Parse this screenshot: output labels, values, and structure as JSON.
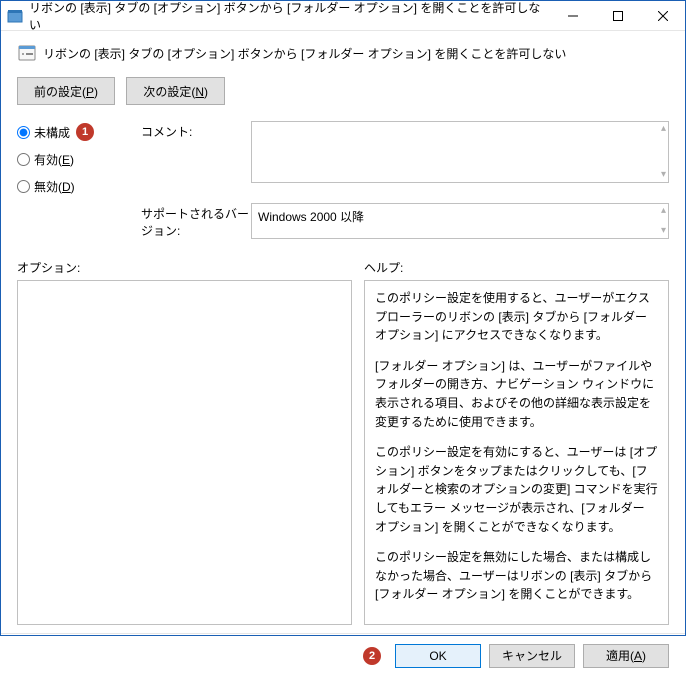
{
  "window": {
    "title": "リボンの [表示] タブの [オプション] ボタンから [フォルダー オプション] を開くことを許可しない"
  },
  "header": {
    "policy_title": "リボンの [表示] タブの [オプション] ボタンから [フォルダー オプション] を開くことを許可しない"
  },
  "nav": {
    "prev": "前の設定(P)",
    "next": "次の設定(N)"
  },
  "radio": {
    "not_configured": "未構成",
    "enabled": "有効(E)",
    "disabled": "無効(D)"
  },
  "comment": {
    "label": "コメント:",
    "value": ""
  },
  "supported": {
    "label": "サポートされるバージョン:",
    "value": "Windows 2000 以降"
  },
  "option": {
    "label": "オプション:"
  },
  "help": {
    "label": "ヘルプ:",
    "p1": "このポリシー設定を使用すると、ユーザーがエクスプローラーのリボンの [表示] タブから [フォルダー オプション] にアクセスできなくなります。",
    "p2": "[フォルダー オプション] は、ユーザーがファイルやフォルダーの開き方、ナビゲーション ウィンドウに表示される項目、およびその他の詳細な表示設定を変更するために使用できます。",
    "p3": "このポリシー設定を有効にすると、ユーザーは [オプション] ボタンをタップまたはクリックしても、[フォルダーと検索のオプションの変更] コマンドを実行してもエラー メッセージが表示され、[フォルダー オプション] を開くことができなくなります。",
    "p4": "このポリシー設定を無効にした場合、または構成しなかった場合、ユーザーはリボンの [表示] タブから [フォルダー オプション] を開くことができます。"
  },
  "footer": {
    "ok": "OK",
    "cancel": "キャンセル",
    "apply": "適用(A)"
  },
  "annotations": {
    "badge1": "1",
    "badge2": "2"
  }
}
